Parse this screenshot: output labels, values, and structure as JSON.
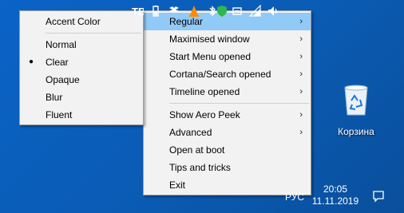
{
  "main_menu": {
    "items": [
      {
        "label": "Regular",
        "has_submenu": true,
        "highlighted": true
      },
      {
        "label": "Maximised window",
        "has_submenu": true
      },
      {
        "label": "Start Menu opened",
        "has_submenu": true
      },
      {
        "label": "Cortana/Search opened",
        "has_submenu": true
      },
      {
        "label": "Timeline opened",
        "has_submenu": true
      }
    ],
    "items2": [
      {
        "label": "Show Aero Peek",
        "has_submenu": true
      },
      {
        "label": "Advanced",
        "has_submenu": true
      },
      {
        "label": "Open at boot"
      },
      {
        "label": "Tips and tricks"
      },
      {
        "label": "Exit"
      }
    ],
    "arrow_glyph": "›"
  },
  "sub_menu": {
    "header": "Accent Color",
    "items": [
      {
        "label": "Normal"
      },
      {
        "label": "Clear",
        "selected": true
      },
      {
        "label": "Opaque"
      },
      {
        "label": "Blur"
      },
      {
        "label": "Fluent"
      }
    ],
    "bullet_glyph": "●"
  },
  "desktop": {
    "recycle_bin_label": "Корзина"
  },
  "taskbar": {
    "tray_icons": [
      "translucenttb-icon",
      "battery-icon",
      "dropbox-icon",
      "vlc-icon",
      "shield-icon",
      "usb-icon",
      "network-icon",
      "volume-icon"
    ],
    "language": "РУС",
    "time": "20:05",
    "date": "11.11.2019"
  },
  "colors": {
    "desktop_blue": "#0a5bb3",
    "menu_bg": "#f2f2f2",
    "highlight": "#91c9f7"
  }
}
